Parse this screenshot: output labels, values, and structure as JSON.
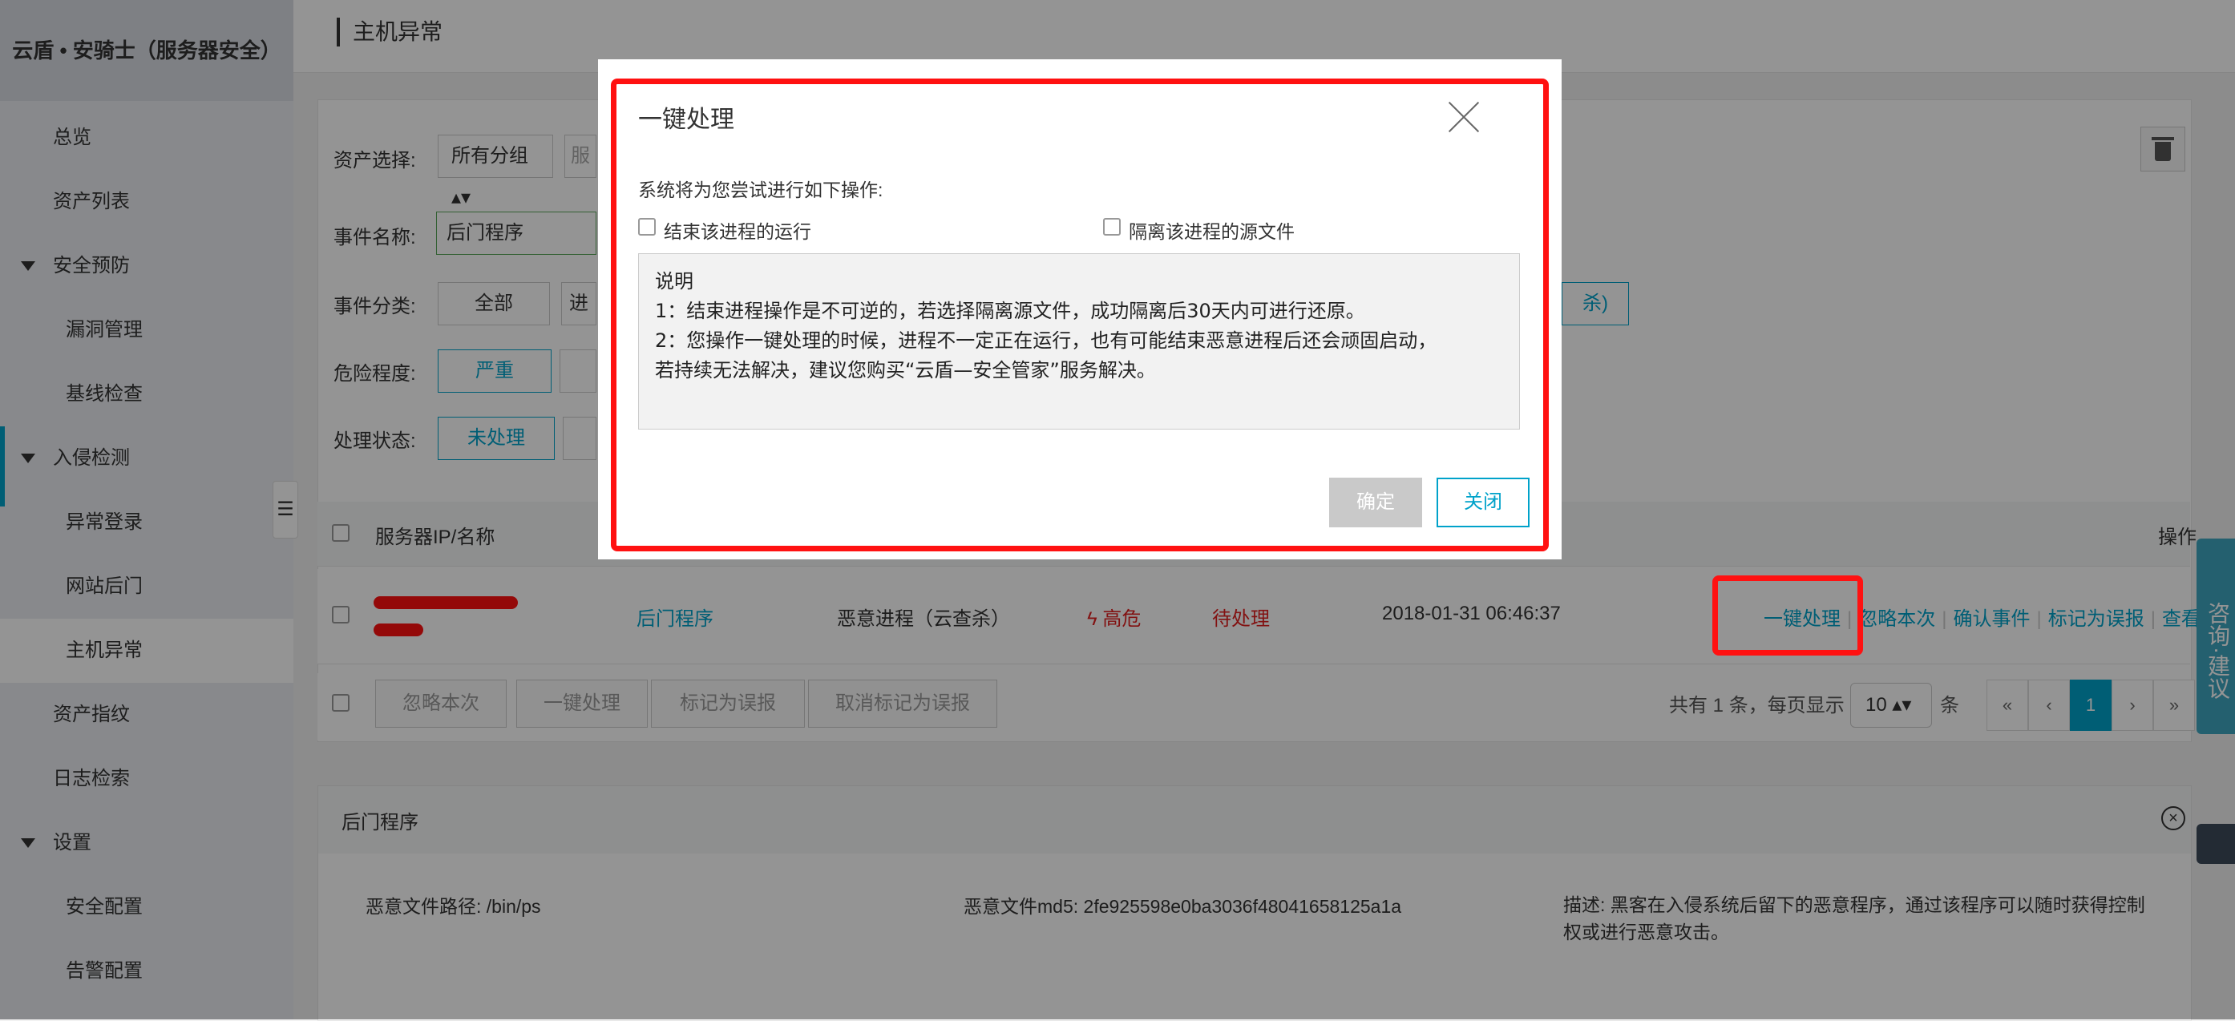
{
  "sidebar": {
    "title": "云盾 • 安骑士（服务器安全）",
    "items": [
      {
        "label": "总览"
      },
      {
        "label": "资产列表"
      },
      {
        "label": "安全预防"
      },
      {
        "label": "漏洞管理"
      },
      {
        "label": "基线检查"
      },
      {
        "label": "入侵检测"
      },
      {
        "label": "异常登录"
      },
      {
        "label": "网站后门"
      },
      {
        "label": "主机异常"
      },
      {
        "label": "资产指纹"
      },
      {
        "label": "日志检索"
      },
      {
        "label": "设置"
      },
      {
        "label": "安全配置"
      },
      {
        "label": "告警配置"
      }
    ]
  },
  "header": {
    "title": "主机异常"
  },
  "filters": {
    "asset_label": "资产选择:",
    "asset_group": "所有分组",
    "asset_server_placeholder": "服",
    "event_name_label": "事件名称:",
    "event_name_value": "后门程序",
    "event_category_label": "事件分类:",
    "category_all": "全部",
    "category_second": "进",
    "category_cloud": "杀)",
    "risk_label": "危险程度:",
    "risk_severe": "严重",
    "status_label": "处理状态:",
    "status_pending": "未处理"
  },
  "table": {
    "header_server": "服务器IP/名称",
    "header_ops": "操作",
    "row": {
      "event": "后门程序",
      "type": "恶意进程（云查杀）",
      "risk": "高危",
      "status": "待处理",
      "time": "2018-01-31 06:46:37",
      "actions": [
        "一键处理",
        "忽略本次",
        "确认事件",
        "标记为误报",
        "查看"
      ]
    },
    "bulk": [
      "忽略本次",
      "一键处理",
      "标记为误报",
      "取消标记为误报"
    ],
    "pagination": {
      "total_prefix": "共有",
      "total": "1",
      "total_suffix": "条，每页显示",
      "page_size": "10",
      "unit": "条",
      "first": "«",
      "prev": "‹",
      "current": "1",
      "next": "›",
      "last": "»"
    }
  },
  "detail": {
    "title": "后门程序",
    "path": "恶意文件路径: /bin/ps",
    "md5": "恶意文件md5: 2fe925598e0ba3036f48041658125a1a",
    "desc": "描述: 黑客在入侵系统后留下的恶意程序，通过该程序可以随时获得控制权或进行恶意攻击。"
  },
  "sidetab": {
    "label": "咨询·建议"
  },
  "modal": {
    "title": "一键处理",
    "intro": "系统将为您尝试进行如下操作:",
    "opt_kill": "结束该进程的运行",
    "opt_isolate": "隔离该进程的源文件",
    "note": {
      "heading": "说明",
      "line1": "1：结束进程操作是不可逆的，若选择隔离源文件，成功隔离后30天内可进行还原。",
      "line2": "2：您操作一键处理的时候，进程不一定正在运行，也有可能结束恶意进程后还会顽固启动，",
      "line3": "若持续无法解决，建议您购买“云盾—安全管家”服务解决。"
    },
    "ok": "确定",
    "close": "关闭"
  },
  "colors": {
    "accent": "#00a2ca",
    "highlight": "#ff1111",
    "danger": "#e02020"
  }
}
